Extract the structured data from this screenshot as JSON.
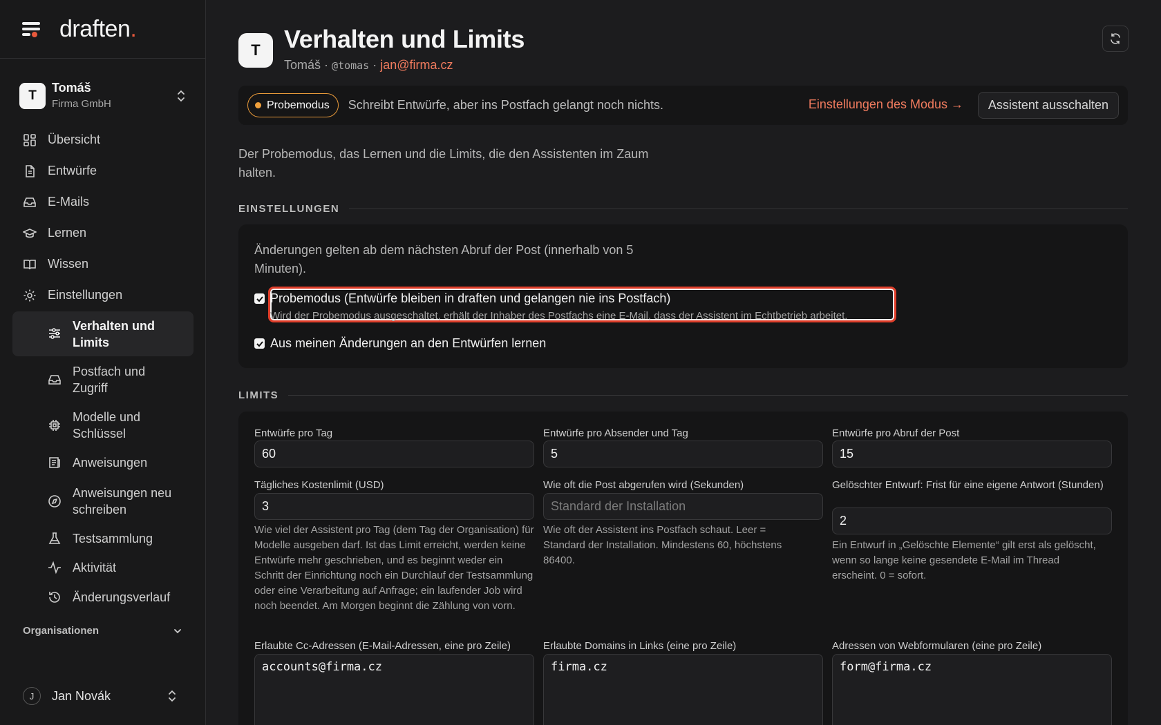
{
  "brand": {
    "name": "draften",
    "dot": "."
  },
  "account": {
    "initial": "T",
    "name": "Tomáš",
    "org": "Firma GmbH"
  },
  "nav": {
    "overview": "Übersicht",
    "drafts": "Entwürfe",
    "emails": "E-Mails",
    "learning": "Lernen",
    "knowledge": "Wissen",
    "settings": "Einstellungen"
  },
  "subnav": {
    "behavior": "Verhalten und Limits",
    "mailbox": "Postfach und Zugriff",
    "models": "Modelle und Schlüssel",
    "instructions": "Anweisungen",
    "rewrite": "Anweisungen neu schreiben",
    "testset": "Testsammlung",
    "activity": "Aktivität",
    "history": "Änderungsverlauf"
  },
  "organizations_label": "Organisationen",
  "user": {
    "initial": "J",
    "name": "Jan Novák"
  },
  "page": {
    "avatar": "T",
    "title": "Verhalten und Limits",
    "sub_name": "Tomáš",
    "sub_sep": " · ",
    "sub_handle": "@tomas",
    "sub_email": "jan@firma.cz"
  },
  "banner": {
    "pill": "Probemodus",
    "text": "Schreibt Entwürfe, aber ins Postfach gelangt noch nichts.",
    "link": "Einstellungen des Modus →",
    "button": "Assistent ausschalten"
  },
  "intro": "Der Probemodus, das Lernen und die Limits, die den Assistenten im Zaum halten.",
  "settings": {
    "heading": "EINSTELLUNGEN",
    "note": "Änderungen gelten ab dem nächsten Abruf der Post (innerhalb von 5 Minuten).",
    "probe_label": "Probemodus (Entwürfe bleiben in draften und gelangen nie ins Postfach)",
    "probe_desc": "Wird der Probemodus ausgeschaltet, erhält der Inhaber des Postfachs eine E-Mail, dass der Assistent im Echtbetrieb arbeitet.",
    "probe_checked": true,
    "learn_label": "Aus meinen Änderungen an den Entwürfen lernen",
    "learn_checked": true
  },
  "limits": {
    "heading": "LIMITS",
    "drafts_per_day_label": "Entwürfe pro Tag",
    "drafts_per_day": "60",
    "drafts_per_sender_label": "Entwürfe pro Absender und Tag",
    "drafts_per_sender": "5",
    "drafts_per_poll_label": "Entwürfe pro Abruf der Post",
    "drafts_per_poll": "15",
    "cost_label": "Tägliches Kostenlimit (USD)",
    "cost": "3",
    "cost_help": "Wie viel der Assistent pro Tag (dem Tag der Organisation) für Modelle ausgeben darf. Ist das Limit erreicht, werden keine Entwürfe mehr geschrieben, und es beginnt weder ein Schritt der Einrichtung noch ein Durchlauf der Testsammlung oder eine Verarbeitung auf Anfrage; ein laufender Job wird noch beendet. Am Morgen beginnt die Zählung von vorn.",
    "poll_label": "Wie oft die Post abgerufen wird (Sekunden)",
    "poll_placeholder": "Standard der Installation",
    "poll_help": "Wie oft der Assistent ins Postfach schaut. Leer = Standard der Installation. Mindestens 60, höchstens 86400.",
    "deleted_label": "Gelöschter Entwurf: Frist für eine eigene Antwort (Stunden)",
    "deleted": "2",
    "deleted_help": "Ein Entwurf in „Gelöschte Elemente“ gilt erst als gelöscht, wenn so lange keine gesendete E-Mail im Thread erscheint. 0 = sofort.",
    "cc_label": "Erlaubte Cc-Adressen (E-Mail-Adressen, eine pro Zeile)",
    "cc_value": "accounts@firma.cz",
    "domains_label": "Erlaubte Domains in Links (eine pro Zeile)",
    "domains_value": "firma.cz",
    "forms_label": "Adressen von Webformularen (eine pro Zeile)",
    "forms_value": "form@firma.cz"
  },
  "colors": {
    "accent": "#e8593c",
    "link": "#f07b5e",
    "pill": "#e89a3a",
    "highlight": "#e03e2a"
  },
  "icons": [
    "menu-icon",
    "updown-icon",
    "grid-icon",
    "file-icon",
    "inbox-icon",
    "graduation-icon",
    "book-icon",
    "gear-icon",
    "sliders-icon",
    "chip-icon",
    "list-icon",
    "compass-icon",
    "flask-icon",
    "activity-icon",
    "history-icon",
    "chevron-down-icon",
    "refresh-icon"
  ]
}
